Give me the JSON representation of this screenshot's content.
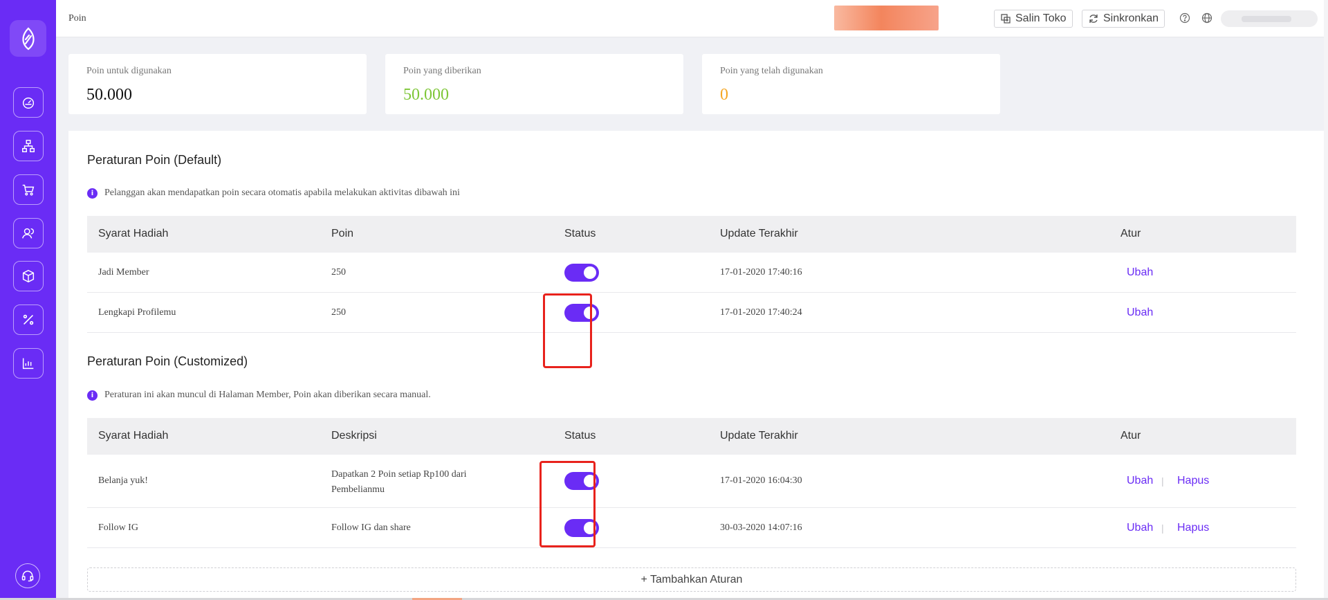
{
  "page": {
    "title": "Poin"
  },
  "sidebar": {
    "logo_icon": "leaf-logo-icon",
    "items": [
      {
        "icon": "dashboard-icon"
      },
      {
        "icon": "sitemap-icon"
      },
      {
        "icon": "cart-icon"
      },
      {
        "icon": "members-icon"
      },
      {
        "icon": "package-icon"
      },
      {
        "icon": "discount-icon"
      },
      {
        "icon": "report-chart-icon"
      }
    ],
    "support_icon": "headset-support-icon"
  },
  "topbar": {
    "copy_store_label": "Salin Toko",
    "sync_label": "Sinkronkan",
    "help_icon": "question-circle-icon",
    "language_icon": "globe-icon"
  },
  "stats": [
    {
      "label": "Poin untuk digunakan",
      "value": "50.000",
      "color": "#111111"
    },
    {
      "label": "Poin yang diberikan",
      "value": "50.000",
      "color": "#7ec637"
    },
    {
      "label": "Poin yang telah digunakan",
      "value": "0",
      "color": "#f5a623"
    }
  ],
  "default_rules": {
    "title": "Peraturan Poin (Default)",
    "info": "Pelanggan akan mendapatkan poin secara otomatis apabila melakukan aktivitas dibawah ini",
    "columns": [
      "Syarat Hadiah",
      "Poin",
      "Status",
      "Update Terakhir",
      "Atur"
    ],
    "rows": [
      {
        "condition": "Jadi Member",
        "points": "250",
        "status_on": true,
        "updated": "17-01-2020 17:40:16",
        "edit": "Ubah"
      },
      {
        "condition": "Lengkapi Profilemu",
        "points": "250",
        "status_on": true,
        "updated": "17-01-2020 17:40:24",
        "edit": "Ubah"
      }
    ]
  },
  "custom_rules": {
    "title": "Peraturan Poin (Customized)",
    "info": "Peraturan ini akan muncul di Halaman Member, Poin akan diberikan secara manual.",
    "columns": [
      "Syarat Hadiah",
      "Deskripsi",
      "Status",
      "Update Terakhir",
      "Atur"
    ],
    "rows": [
      {
        "condition": "Belanja yuk!",
        "description": "Dapatkan 2 Poin setiap Rp100 dari Pembelianmu",
        "status_on": true,
        "updated": "17-01-2020 16:04:30",
        "edit": "Ubah",
        "delete": "Hapus",
        "separator": "|"
      },
      {
        "condition": "Follow IG",
        "description": "Follow IG dan share",
        "status_on": true,
        "updated": "30-03-2020 14:07:16",
        "edit": "Ubah",
        "delete": "Hapus",
        "separator": "|"
      }
    ],
    "add_button": "+ Tambahkan Aturan"
  },
  "colors": {
    "primary": "#6a2cf5",
    "highlight": "#e8221c"
  }
}
